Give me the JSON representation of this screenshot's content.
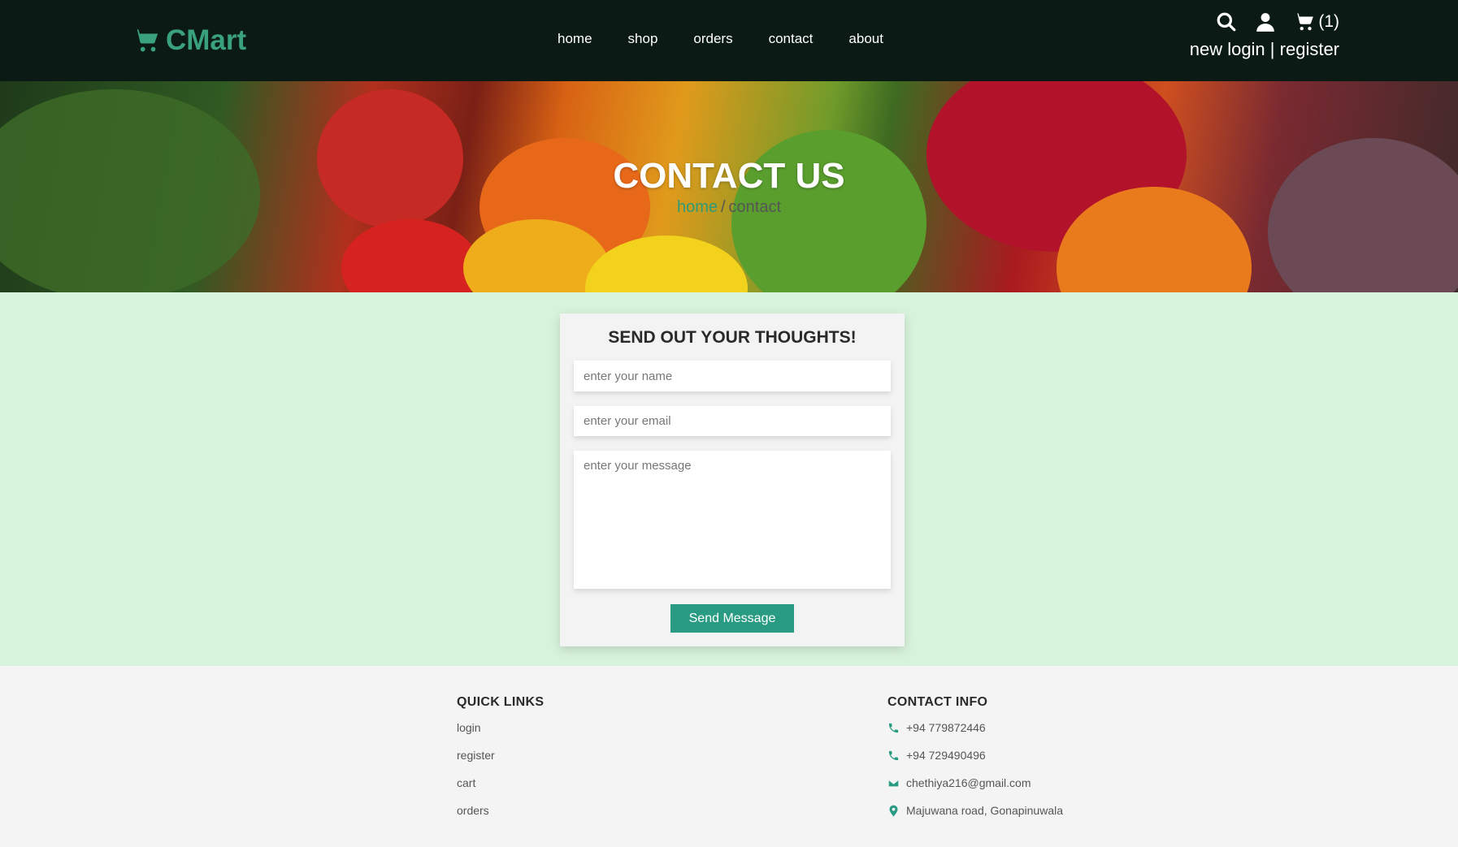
{
  "header": {
    "brand": "CMart",
    "nav": [
      "home",
      "shop",
      "orders",
      "contact",
      "about"
    ],
    "cart_count": "(1)",
    "auth": {
      "login": "new login",
      "separator": "|",
      "register": "register"
    }
  },
  "hero": {
    "title": "CONTACT US",
    "breadcrumb": {
      "home": "home",
      "separator": "/",
      "current": "contact"
    }
  },
  "form": {
    "title": "SEND OUT YOUR THOUGHTS!",
    "name_placeholder": "enter your name",
    "email_placeholder": "enter your email",
    "message_placeholder": "enter your message",
    "submit_label": "Send Message"
  },
  "footer": {
    "quick_links": {
      "title": "QUICK LINKS",
      "items": [
        "login",
        "register",
        "cart",
        "orders"
      ]
    },
    "contact_info": {
      "title": "CONTACT INFO",
      "phone1": "+94 779872446",
      "phone2": "+94 729490496",
      "email": "chethiya216@gmail.com",
      "address": "Majuwana road, Gonapinuwala"
    }
  },
  "colors": {
    "accent": "#2a9b83",
    "header_bg": "#0b1a14",
    "page_bg": "#d8f3dc",
    "brand": "#3aa17e"
  }
}
